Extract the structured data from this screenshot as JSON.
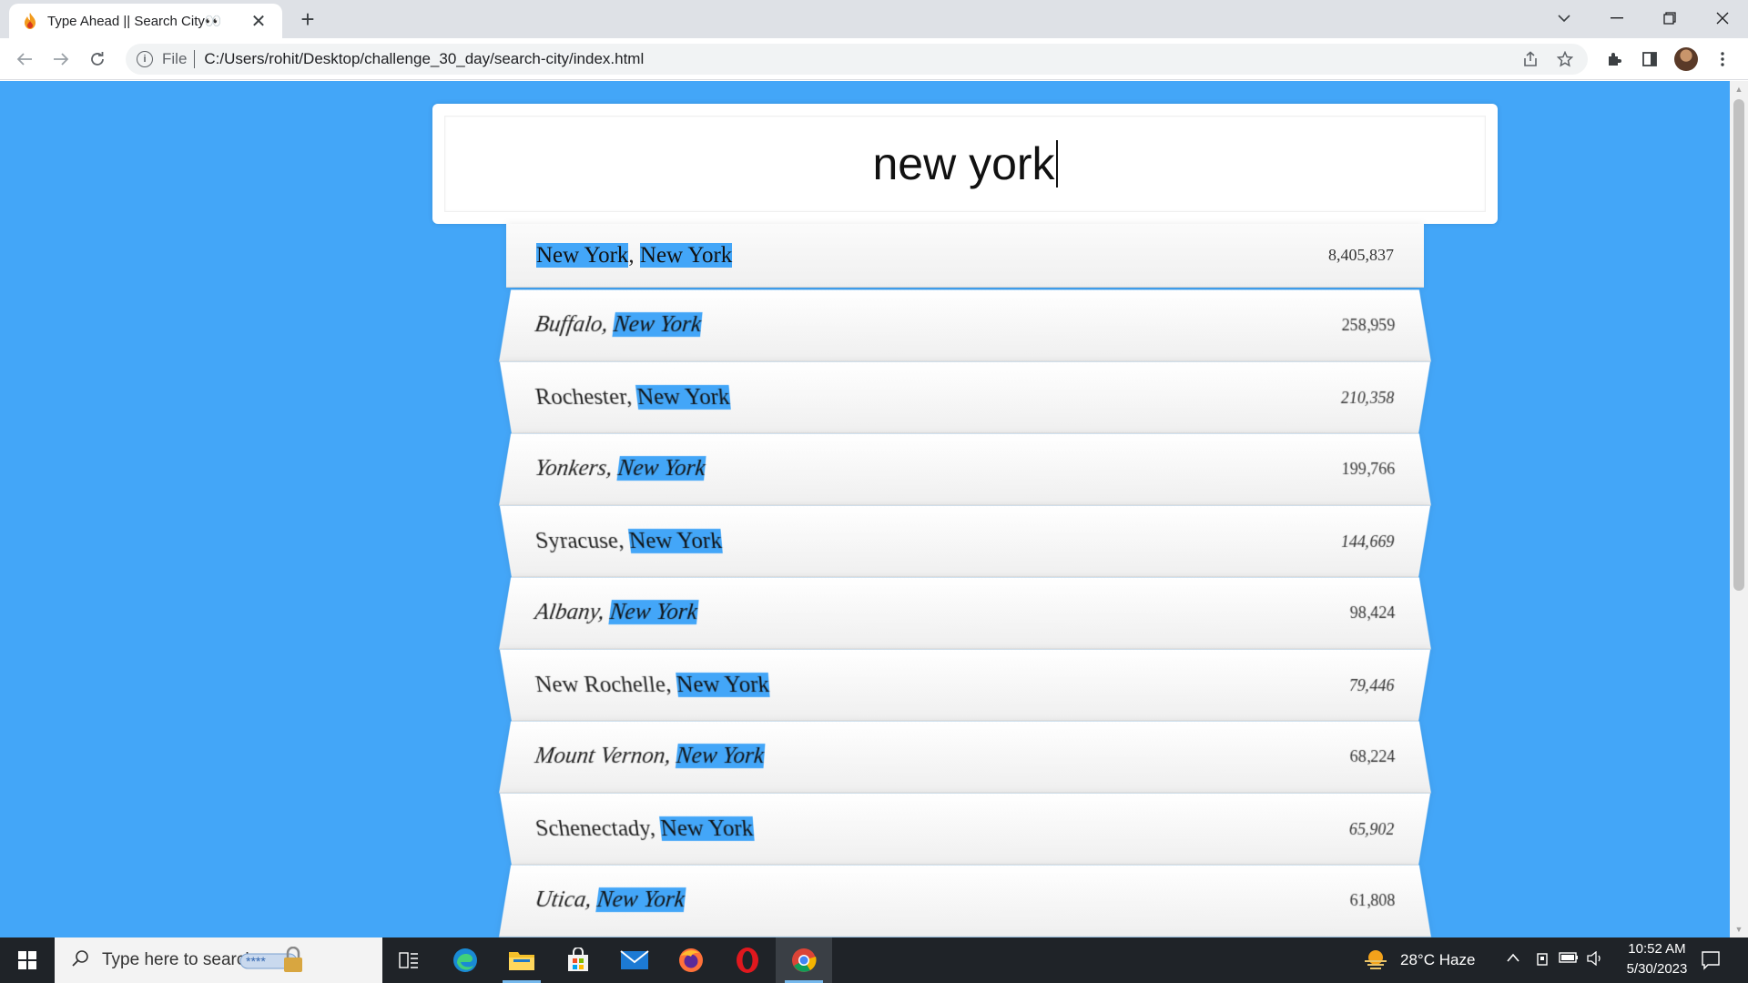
{
  "browser": {
    "tab_title": "Type Ahead || Search City👀",
    "tab_close": "✕",
    "new_tab": "+",
    "scheme_label": "File",
    "url": "C:/Users/rohit/Desktop/challenge_30_day/search-city/index.html"
  },
  "search": {
    "value": "new york"
  },
  "suggestions": [
    {
      "city": "New York",
      "sep": ", ",
      "state": "New York",
      "population": "8,405,837",
      "city_highlight": true
    },
    {
      "city": "Buffalo",
      "sep": ", ",
      "state": "New York",
      "population": "258,959",
      "city_highlight": false
    },
    {
      "city": "Rochester",
      "sep": ", ",
      "state": "New York",
      "population": "210,358",
      "city_highlight": false
    },
    {
      "city": "Yonkers",
      "sep": ", ",
      "state": "New York",
      "population": "199,766",
      "city_highlight": false
    },
    {
      "city": "Syracuse",
      "sep": ", ",
      "state": "New York",
      "population": "144,669",
      "city_highlight": false
    },
    {
      "city": "Albany",
      "sep": ", ",
      "state": "New York",
      "population": "98,424",
      "city_highlight": false
    },
    {
      "city": "New Rochelle",
      "sep": ", ",
      "state": "New York",
      "population": "79,446",
      "city_highlight": false
    },
    {
      "city": "Mount Vernon",
      "sep": ", ",
      "state": "New York",
      "population": "68,224",
      "city_highlight": false
    },
    {
      "city": "Schenectady",
      "sep": ", ",
      "state": "New York",
      "population": "65,902",
      "city_highlight": false
    },
    {
      "city": "Utica",
      "sep": ", ",
      "state": "New York",
      "population": "61,808",
      "city_highlight": false
    }
  ],
  "taskbar": {
    "search_placeholder": "Type here to search",
    "weather": "28°C  Haze",
    "time": "10:52 AM",
    "date": "5/30/2023"
  },
  "colors": {
    "page_background": "#43a6f8",
    "highlight": "#43a6f8"
  }
}
